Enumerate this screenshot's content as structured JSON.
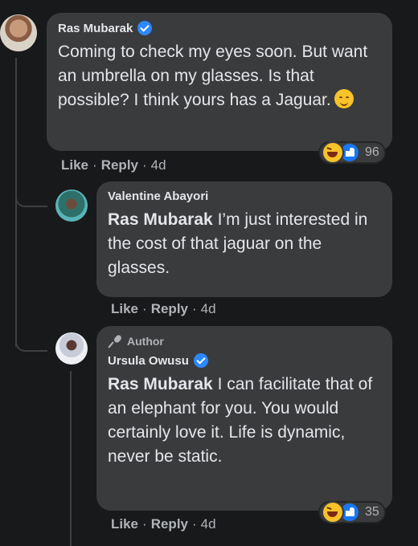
{
  "comments": [
    {
      "author": "Ras Mubarak",
      "verified": true,
      "text": "Coming to check my eyes soon. But want an umbrella on my glasses. Is that possible? I think yours has a Jaguar.",
      "emoji": "smiling-face-icon",
      "actions": {
        "like": "Like",
        "reply": "Reply",
        "time": "4d"
      },
      "reaction_count": "96",
      "reaction_icons": [
        "haha-icon",
        "like-icon"
      ]
    },
    {
      "author": "Valentine Abayori",
      "verified": false,
      "mention": "Ras Mubarak",
      "text": "I’m just interested in the cost of that jaguar on the glasses.",
      "actions": {
        "like": "Like",
        "reply": "Reply",
        "time": "4d"
      }
    },
    {
      "badge": "Author",
      "author": "Ursula Owusu",
      "verified": true,
      "mention": "Ras Mubarak",
      "text": "I can facilitate that of an elephant for you. You would certainly love it. Life is dynamic, never be static.",
      "actions": {
        "like": "Like",
        "reply": "Reply",
        "time": "4d"
      },
      "reaction_count": "35",
      "reaction_icons": [
        "haha-icon",
        "like-icon"
      ]
    }
  ],
  "separator": "·",
  "colors": {
    "background": "#18191a",
    "bubble": "#3a3b3c",
    "text": "#e4e6eb",
    "muted": "#b0b3b8",
    "verified": "#2d88ff"
  }
}
